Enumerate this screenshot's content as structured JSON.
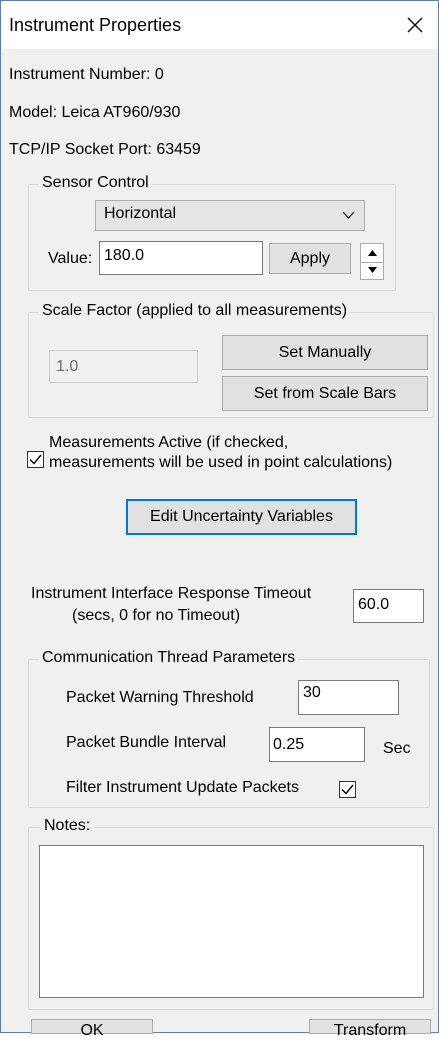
{
  "window": {
    "title": "Instrument Properties"
  },
  "info": {
    "instrument_number": "Instrument Number:  0",
    "model": "Model:  Leica AT960/930",
    "port": "TCP/IP Socket Port: 63459"
  },
  "sensor_control": {
    "legend": "Sensor Control",
    "mode_selected": "Horizontal",
    "value_label": "Value:",
    "value": "180.0",
    "apply_label": "Apply"
  },
  "scale_factor": {
    "legend": "Scale Factor (applied to all measurements)",
    "value": "1.0",
    "set_manually_label": "Set Manually",
    "set_from_bars_label": "Set from Scale Bars"
  },
  "measurements": {
    "active_checked": true,
    "label_line1": "Measurements Active (if checked,",
    "label_line2": "measurements will be used in point calculations)",
    "edit_uncertainty_label": "Edit Uncertainty Variables"
  },
  "timeout": {
    "label_line1": "Instrument Interface Response Timeout",
    "label_line2": "(secs, 0 for no Timeout)",
    "value": "60.0"
  },
  "comm": {
    "legend": "Communication Thread Parameters",
    "warning_label": "Packet Warning Threshold",
    "warning_value": "30",
    "bundle_label": "Packet Bundle Interval",
    "bundle_value": "0.25",
    "bundle_unit": "Sec",
    "filter_label": "Filter Instrument Update Packets",
    "filter_checked": true
  },
  "notes": {
    "legend": "Notes:",
    "value": ""
  },
  "footer": {
    "ok_label": "OK",
    "transform_label": "Transform"
  }
}
